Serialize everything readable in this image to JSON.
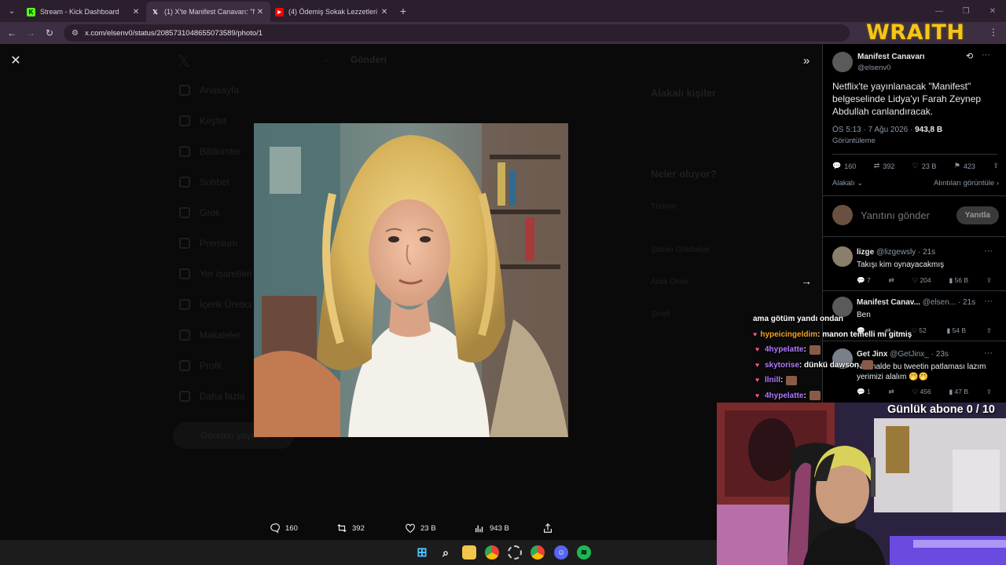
{
  "browser": {
    "tabs": [
      {
        "title": "Stream - Kick Dashboard",
        "favicon": "kick-icon",
        "color": "#53fc18"
      },
      {
        "title": "(1) X'te Manifest Canavarı: \"Netf",
        "favicon": "x-icon",
        "color": "#ffffff"
      },
      {
        "title": "(4) Ödemiş Sokak Lezzetleri ! -",
        "favicon": "youtube-icon",
        "color": "#ff0000"
      }
    ],
    "url": "x.com/elsenv0/status/2085731048655073589/photo/1"
  },
  "overlay_brand": "WRAITH",
  "background_page": {
    "header": "Gönderi",
    "nav_items": [
      "Anasayfa",
      "Keşfet",
      "Bildirimler",
      "Sohbet",
      "Grok",
      "Premium",
      "Yer işaretleri",
      "İçerik Üretici",
      "Makaleler",
      "Profil",
      "Daha fazla"
    ],
    "post_button": "Gönderi yayınla",
    "right_title_1": "Alakalı kişiler",
    "right_title_2": "Neler oluyor?",
    "trends": [
      "Türkiye",
      "Şahan Gökbakar",
      "Arda Okan",
      "Şeref"
    ]
  },
  "photo_actions": {
    "replies": "160",
    "reposts": "392",
    "likes": "23 B",
    "views": "943 B"
  },
  "tweet": {
    "author_name": "Manifest Canavarı",
    "author_handle": "@elsenv0",
    "text": "Netflix'te yayınlanacak \"Manifest\" belgeselinde Lidya'yı Farah Zeynep Abdullah canlandıracak.",
    "time": "ÖS 5:13 · 7 Ağu 2026",
    "views_count": "943,8 B",
    "views_label": "Görüntüleme",
    "stats": {
      "replies": "160",
      "reposts": "392",
      "likes": "23 B",
      "bookmarks": "423"
    },
    "sort_label": "Alakalı",
    "quotes_label": "Alıntıları görüntüle",
    "reply_placeholder": "Yanıtını gönder",
    "reply_button": "Yanıtla"
  },
  "replies": [
    {
      "name": "lizge",
      "handle": "@lizgewsly · 21s",
      "text": "Takışı kim oynayacakmış",
      "replies": "7",
      "reposts": "",
      "likes": "204",
      "views": "56 B"
    },
    {
      "name": "Manifest Canav...",
      "handle": "@elsen... · 21s",
      "text": "Ben",
      "replies": "",
      "reposts": "",
      "likes": "52",
      "views": "54 B"
    },
    {
      "name": "Get Jinx",
      "handle": "@GetJinx_ · 23s",
      "text": "Normalde bu tweetin patlaması lazım yerimizi alalım 🤭🤭",
      "replies": "1",
      "reposts": "",
      "likes": "456",
      "views": "47 B"
    }
  ],
  "chat": [
    {
      "user": "",
      "color": "#ffffff",
      "message": "ama götüm yandı ondan",
      "badge": false,
      "emote": false
    },
    {
      "user": "hypeicingeldim",
      "color": "#f5a623",
      "message": " : manon temelli mi gitmiş",
      "badge": true,
      "emote": false
    },
    {
      "user": "4hypelatte",
      "color": "#b07cff",
      "message": " :",
      "badge": true,
      "emote": true
    },
    {
      "user": "skytorise",
      "color": "#b07cff",
      "message": " : dünkü dawson",
      "badge": true,
      "emote": true
    },
    {
      "user": "llnill",
      "color": "#b07cff",
      "message": " :",
      "badge": true,
      "emote": true
    },
    {
      "user": "4hypelatte",
      "color": "#b07cff",
      "message": " :",
      "badge": true,
      "emote": true
    }
  ],
  "sub_goal": "Günlük abone 0 / 10"
}
